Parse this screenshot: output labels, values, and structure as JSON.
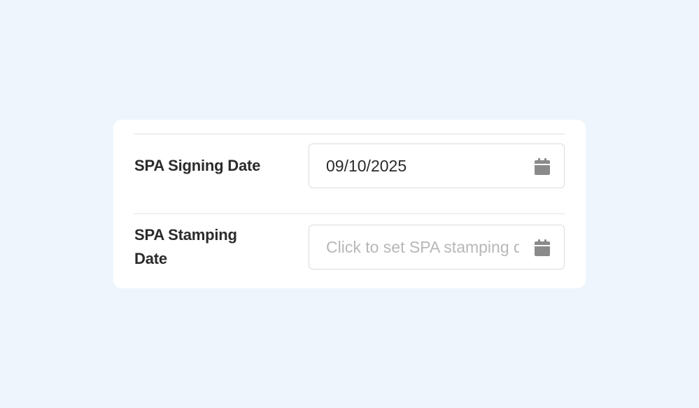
{
  "form": {
    "rows": [
      {
        "label": "SPA Signing Date",
        "value": "09/10/2025",
        "placeholder": "",
        "icon": "calendar-icon"
      },
      {
        "label": "SPA Stamping Date",
        "value": "",
        "placeholder": "Click to set SPA stamping date",
        "icon": "calendar-icon"
      }
    ]
  },
  "colors": {
    "background": "#eef5fd",
    "card": "#ffffff",
    "label_text": "#2b2b2b",
    "value_text": "#2a2a2a",
    "placeholder_text": "#b7b7b7",
    "icon": "#8a8a8a",
    "border": "#dcdcdc"
  }
}
